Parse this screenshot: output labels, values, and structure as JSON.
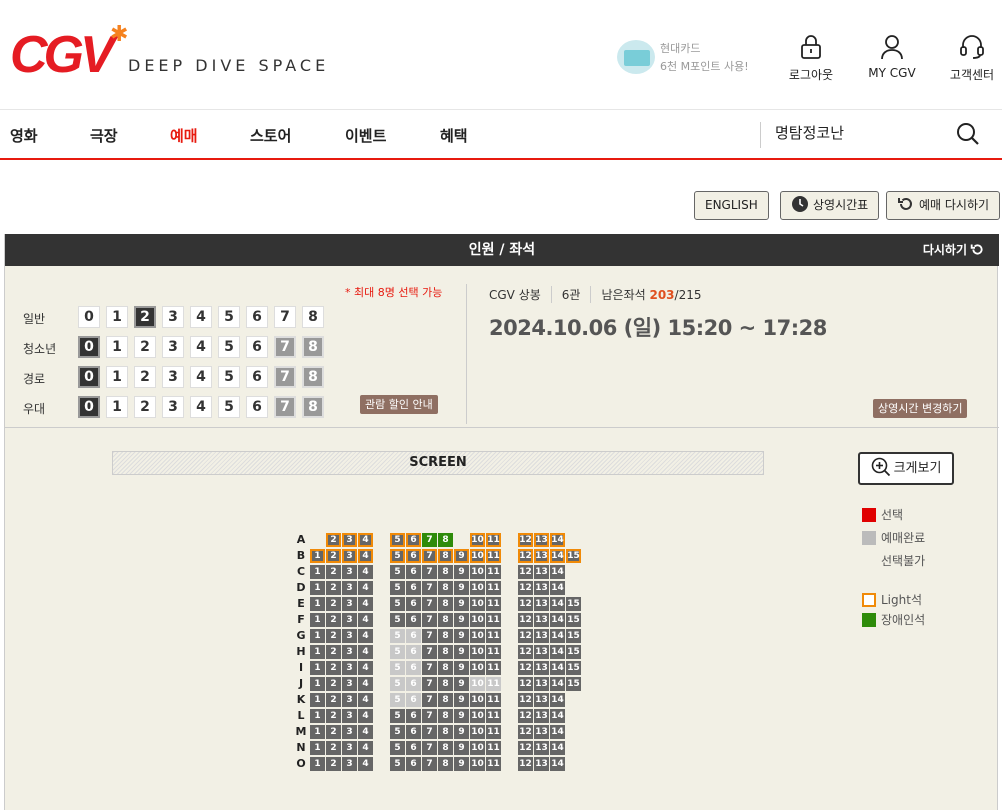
{
  "header": {
    "logo_text": "CGV",
    "tagline": "DEEP DIVE SPACE",
    "promo": {
      "line1": "현대카드",
      "line2": "6천 M포인트 사용!"
    },
    "logout": "로그아웃",
    "mycgv": "MY CGV",
    "support": "고객센터"
  },
  "nav": {
    "items": [
      "영화",
      "극장",
      "예매",
      "스토어",
      "이벤트",
      "혜택"
    ],
    "active": "예매",
    "search_value": "명탐정코난"
  },
  "top_buttons": {
    "english": "ENGLISH",
    "timetable": "상영시간표",
    "restart": "예매 다시하기"
  },
  "panel": {
    "title": "인원 / 좌석",
    "reset": "다시하기",
    "max_note": "* 최대 8명 선택 가능",
    "discount_btn": "관람 할인 안내",
    "change_time_btn": "상영시간 변경하기",
    "zoom_btn": "크게보기",
    "screen_label": "SCREEN"
  },
  "people": [
    {
      "label": "일반",
      "selected": 2,
      "max_enabled": 8
    },
    {
      "label": "청소년",
      "selected": 0,
      "max_enabled": 6
    },
    {
      "label": "경로",
      "selected": 0,
      "max_enabled": 6
    },
    {
      "label": "우대",
      "selected": 0,
      "max_enabled": 6
    }
  ],
  "numbers": [
    "0",
    "1",
    "2",
    "3",
    "4",
    "5",
    "6",
    "7",
    "8"
  ],
  "showing": {
    "theater": "CGV 상봉",
    "hall": "6관",
    "remaining_label": "남은좌석",
    "remaining": "203",
    "total": "/215",
    "datetime": "2024.10.06 (일) 15:20 ~ 17:28"
  },
  "legend": {
    "selected": "선택",
    "reserved": "예매완료",
    "unavailable": "선택불가",
    "light": "Light석",
    "handicap": "장애인석"
  },
  "colors": {
    "brand": "#e71a0f",
    "seat": "#666666",
    "light_border": "#f08a08",
    "handicap": "#2e8b0a",
    "unavailable": "#c8c8c8"
  },
  "seat_map": {
    "rows": [
      "A",
      "B",
      "C",
      "D",
      "E",
      "F",
      "G",
      "H",
      "I",
      "J",
      "K",
      "L",
      "M",
      "N",
      "O"
    ],
    "seats": {
      "A": {
        "seats": [
          2,
          3,
          4,
          5,
          6,
          7,
          8,
          10,
          11,
          12,
          13,
          14
        ],
        "light": [
          2,
          3,
          4,
          5,
          6,
          10,
          11,
          12,
          13,
          14
        ],
        "handicap": [
          7,
          8
        ]
      },
      "B": {
        "seats": [
          1,
          2,
          3,
          4,
          5,
          6,
          7,
          8,
          9,
          10,
          11,
          12,
          13,
          14,
          15
        ],
        "light": [
          1,
          2,
          3,
          4,
          5,
          6,
          7,
          8,
          9,
          10,
          11,
          12,
          13,
          14,
          15
        ]
      },
      "C": {
        "seats": [
          1,
          2,
          3,
          4,
          5,
          6,
          7,
          8,
          9,
          10,
          11,
          12,
          13,
          14
        ]
      },
      "D": {
        "seats": [
          1,
          2,
          3,
          4,
          5,
          6,
          7,
          8,
          9,
          10,
          11,
          12,
          13,
          14
        ]
      },
      "E": {
        "seats": [
          1,
          2,
          3,
          4,
          5,
          6,
          7,
          8,
          9,
          10,
          11,
          12,
          13,
          14,
          15
        ]
      },
      "F": {
        "seats": [
          1,
          2,
          3,
          4,
          5,
          6,
          7,
          8,
          9,
          10,
          11,
          12,
          13,
          14,
          15
        ]
      },
      "G": {
        "seats": [
          1,
          2,
          3,
          4,
          5,
          6,
          7,
          8,
          9,
          10,
          11,
          12,
          13,
          14,
          15
        ],
        "unavailable": [
          5,
          6
        ]
      },
      "H": {
        "seats": [
          1,
          2,
          3,
          4,
          5,
          6,
          7,
          8,
          9,
          10,
          11,
          12,
          13,
          14,
          15
        ],
        "unavailable": [
          5,
          6
        ]
      },
      "I": {
        "seats": [
          1,
          2,
          3,
          4,
          5,
          6,
          7,
          8,
          9,
          10,
          11,
          12,
          13,
          14,
          15
        ],
        "unavailable": [
          5,
          6
        ]
      },
      "J": {
        "seats": [
          1,
          2,
          3,
          4,
          5,
          6,
          7,
          8,
          9,
          10,
          11,
          12,
          13,
          14,
          15
        ],
        "unavailable": [
          5,
          6,
          10,
          11
        ]
      },
      "K": {
        "seats": [
          1,
          2,
          3,
          4,
          5,
          6,
          7,
          8,
          9,
          10,
          11,
          12,
          13,
          14
        ],
        "unavailable": [
          5,
          6
        ]
      },
      "L": {
        "seats": [
          1,
          2,
          3,
          4,
          5,
          6,
          7,
          8,
          9,
          10,
          11,
          12,
          13,
          14
        ]
      },
      "M": {
        "seats": [
          1,
          2,
          3,
          4,
          5,
          6,
          7,
          8,
          9,
          10,
          11,
          12,
          13,
          14
        ]
      },
      "N": {
        "seats": [
          1,
          2,
          3,
          4,
          5,
          6,
          7,
          8,
          9,
          10,
          11,
          12,
          13,
          14
        ]
      },
      "O": {
        "seats": [
          1,
          2,
          3,
          4,
          5,
          6,
          7,
          8,
          9,
          10,
          11,
          12,
          13,
          14
        ]
      }
    }
  }
}
